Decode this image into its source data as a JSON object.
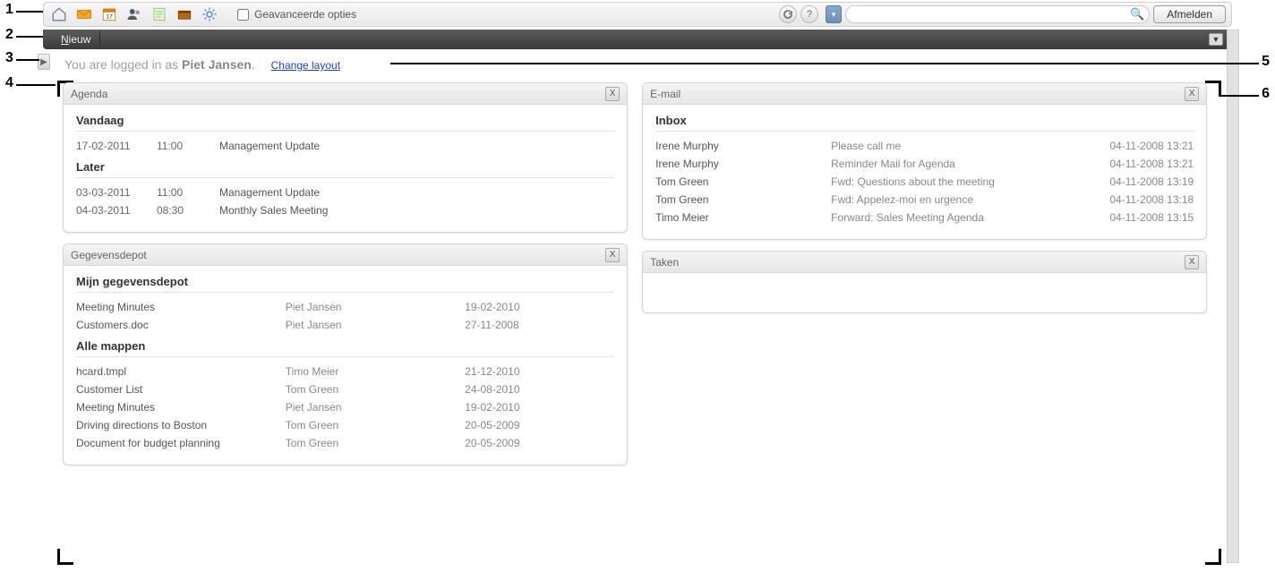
{
  "toolbar": {
    "advanced_options_label": "Geavanceerde opties",
    "logout_label": "Afmelden"
  },
  "panelbar": {
    "new_label": "Nieuw"
  },
  "login": {
    "prefix": "You are logged in as ",
    "user": "Piet Jansen",
    "suffix": ".",
    "change_layout": "Change layout"
  },
  "agenda": {
    "title": "Agenda",
    "today_label": "Vandaag",
    "later_label": "Later",
    "today": [
      {
        "date": "17-02-2011",
        "time": "11:00",
        "title": "Management Update"
      }
    ],
    "later": [
      {
        "date": "03-03-2011",
        "time": "11:00",
        "title": "Management Update"
      },
      {
        "date": "04-03-2011",
        "time": "08:30",
        "title": "Monthly Sales Meeting"
      }
    ]
  },
  "depot": {
    "title": "Gegevensdepot",
    "mine_label": "Mijn gegevensdepot",
    "all_label": "Alle mappen",
    "mine": [
      {
        "name": "Meeting Minutes",
        "owner": "Piet Jansen",
        "date": "19-02-2010"
      },
      {
        "name": "Customers.doc",
        "owner": "Piet Jansen",
        "date": "27-11-2008"
      }
    ],
    "all": [
      {
        "name": "hcard.tmpl",
        "owner": "Timo Meier",
        "date": "21-12-2010"
      },
      {
        "name": "Customer List",
        "owner": "Tom Green",
        "date": "24-08-2010"
      },
      {
        "name": "Meeting Minutes",
        "owner": "Piet Jansen",
        "date": "19-02-2010"
      },
      {
        "name": "Driving directions to Boston",
        "owner": "Tom Green",
        "date": "20-05-2009"
      },
      {
        "name": "Document for budget planning",
        "owner": "Tom Green",
        "date": "20-05-2009"
      }
    ]
  },
  "email": {
    "title": "E-mail",
    "inbox_label": "Inbox",
    "rows": [
      {
        "from": "Irene Murphy",
        "subject": "Please call me",
        "date": "04-11-2008 13:21"
      },
      {
        "from": "Irene Murphy",
        "subject": "Reminder Mail for Agenda",
        "date": "04-11-2008 13:21"
      },
      {
        "from": "Tom Green",
        "subject": "Fwd: Questions about the meeting",
        "date": "04-11-2008 13:19"
      },
      {
        "from": "Tom Green",
        "subject": "Fwd: Appelez-moi en urgence",
        "date": "04-11-2008 13:18"
      },
      {
        "from": "Timo Meier",
        "subject": "Forward: Sales Meeting Agenda",
        "date": "04-11-2008 13:15"
      }
    ]
  },
  "tasks": {
    "title": "Taken"
  },
  "callouts": {
    "c1": "1",
    "c2": "2",
    "c3": "3",
    "c4": "4",
    "c5": "5",
    "c6": "6"
  }
}
